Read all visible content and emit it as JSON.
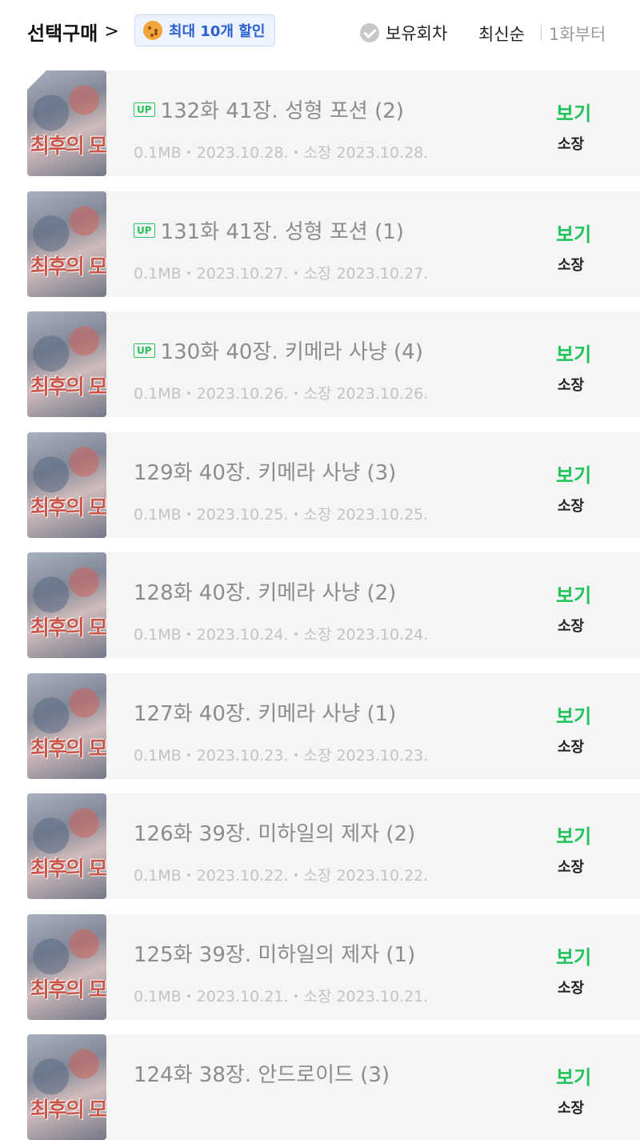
{
  "header": {
    "select_purchase": "선택구매",
    "chevron": ">",
    "discount_badge": "최대 10개 할인",
    "owned_filter": "보유회차",
    "sort_latest": "최신순",
    "sort_first": "1화부터"
  },
  "thumbnail_title": "최후의 모험가",
  "episodes": [
    {
      "up": "UP",
      "title": "132화 41장. 성형 포션 (2)",
      "meta": "0.1MB・2023.10.28.・소장 2023.10.28.",
      "action": "보기",
      "status": "소장"
    },
    {
      "up": "UP",
      "title": "131화 41장. 성형 포션 (1)",
      "meta": "0.1MB・2023.10.27.・소장 2023.10.27.",
      "action": "보기",
      "status": "소장"
    },
    {
      "up": "UP",
      "title": "130화 40장. 키메라 사냥 (4)",
      "meta": "0.1MB・2023.10.26.・소장 2023.10.26.",
      "action": "보기",
      "status": "소장"
    },
    {
      "up": "",
      "title": "129화 40장. 키메라 사냥 (3)",
      "meta": "0.1MB・2023.10.25.・소장 2023.10.25.",
      "action": "보기",
      "status": "소장"
    },
    {
      "up": "",
      "title": "128화 40장. 키메라 사냥 (2)",
      "meta": "0.1MB・2023.10.24.・소장 2023.10.24.",
      "action": "보기",
      "status": "소장"
    },
    {
      "up": "",
      "title": "127화 40장. 키메라 사냥 (1)",
      "meta": "0.1MB・2023.10.23.・소장 2023.10.23.",
      "action": "보기",
      "status": "소장"
    },
    {
      "up": "",
      "title": "126화 39장. 미하일의 제자 (2)",
      "meta": "0.1MB・2023.10.22.・소장 2023.10.22.",
      "action": "보기",
      "status": "소장"
    },
    {
      "up": "",
      "title": "125화 39장. 미하일의 제자 (1)",
      "meta": "0.1MB・2023.10.21.・소장 2023.10.21.",
      "action": "보기",
      "status": "소장"
    },
    {
      "up": "",
      "title": "124화 38장. 안드로이드 (3)",
      "meta": "",
      "action": "보기",
      "status": "소장"
    }
  ],
  "colors": {
    "accent_green": "#1ec45a",
    "badge_blue": "#2a5fcf"
  }
}
